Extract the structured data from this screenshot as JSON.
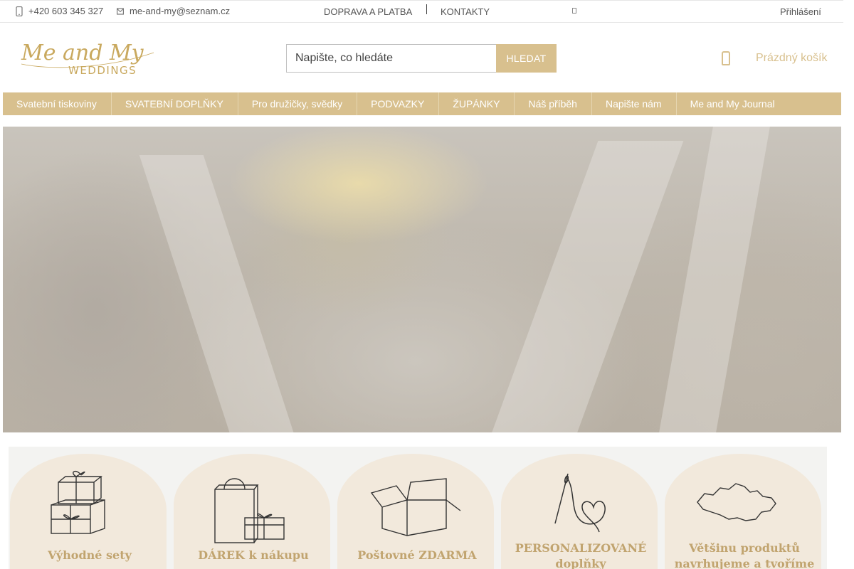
{
  "topbar": {
    "phone": "+420 603 345 327",
    "email": "me-and-my@seznam.cz",
    "shipping_link": "DOPRAVA A PLATBA",
    "contacts_link": "KONTAKTY",
    "login_link": "Přihlášení"
  },
  "header": {
    "logo_script": "Me and My",
    "logo_caps": "WEDDINGS",
    "search_placeholder": "Napište, co hledáte",
    "search_button": "HLEDAT",
    "cart_label": "Prázdný košík"
  },
  "nav": {
    "items": [
      {
        "label": "Svatební tiskoviny"
      },
      {
        "label": "SVATEBNÍ DOPLŇKY"
      },
      {
        "label": "Pro družičky, svědky"
      },
      {
        "label": "PODVAZKY"
      },
      {
        "label": "ŽUPÁNKY"
      },
      {
        "label": "Náš příběh"
      },
      {
        "label": "Napište nám"
      },
      {
        "label": "Me and My Journal"
      }
    ]
  },
  "features": [
    {
      "line1": "Výhodné sety",
      "icon": "gift-boxes-icon"
    },
    {
      "line1": "DÁREK k nákupu",
      "icon": "shopping-bag-gift-icon"
    },
    {
      "line1": "Poštovné ZDARMA",
      "icon": "open-box-icon"
    },
    {
      "line1": "PERSONALIZOVANÉ",
      "line2": "doplňky",
      "icon": "needle-thread-icon"
    },
    {
      "line1": "Většinu produktů",
      "line2": "navrhujeme a tvoříme",
      "icon": "czech-map-icon"
    }
  ],
  "colors": {
    "accent": "#d8c08e",
    "feature_text": "#c1a46f",
    "feature_blob": "#f2e9dc"
  }
}
